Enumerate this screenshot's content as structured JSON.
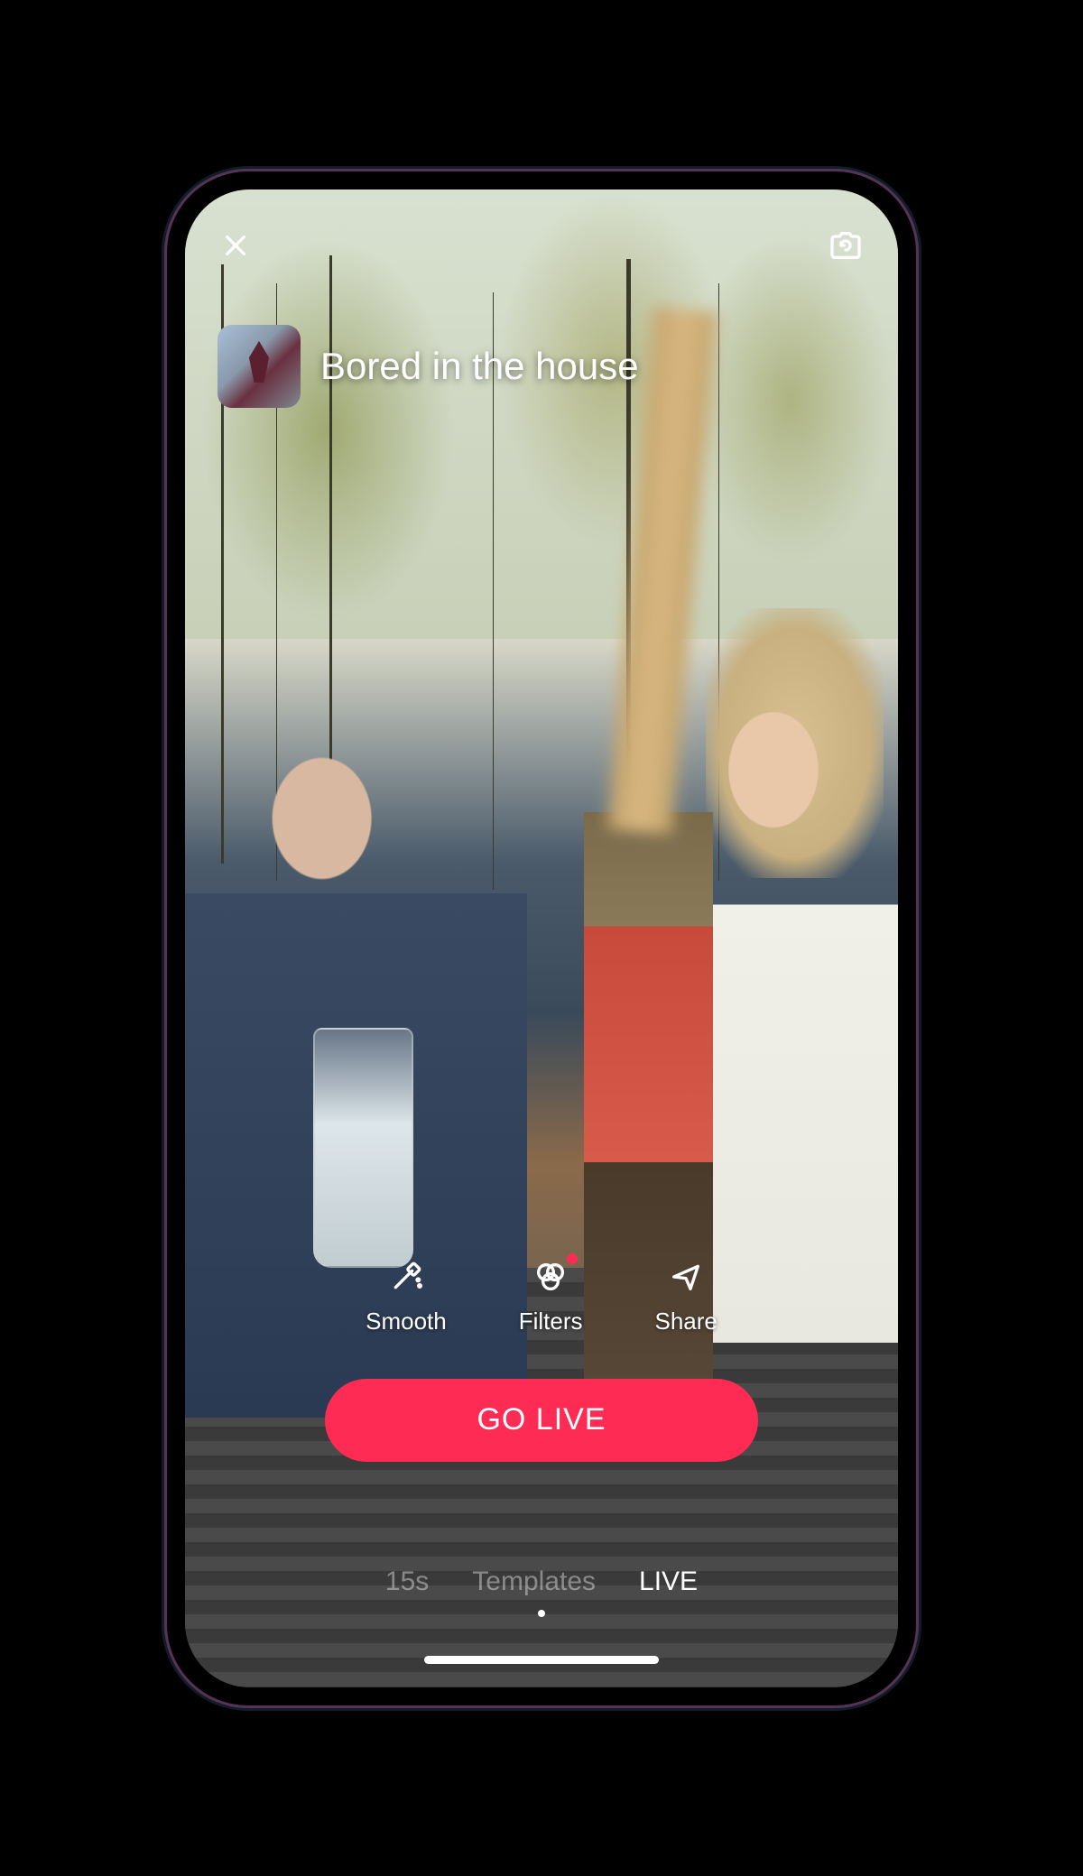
{
  "stream": {
    "title": "Bored in the house"
  },
  "topControls": {
    "close": "close-icon",
    "flipCamera": "camera-flip-icon"
  },
  "actions": [
    {
      "key": "smooth",
      "label": "Smooth",
      "badge": false
    },
    {
      "key": "filters",
      "label": "Filters",
      "badge": true
    },
    {
      "key": "share",
      "label": "Share",
      "badge": false
    }
  ],
  "primaryButton": {
    "label": "GO LIVE"
  },
  "modes": [
    {
      "key": "15s",
      "label": "15s",
      "active": false
    },
    {
      "key": "templates",
      "label": "Templates",
      "active": false
    },
    {
      "key": "live",
      "label": "LIVE",
      "active": true
    }
  ],
  "colors": {
    "accent": "#fe2c55"
  }
}
